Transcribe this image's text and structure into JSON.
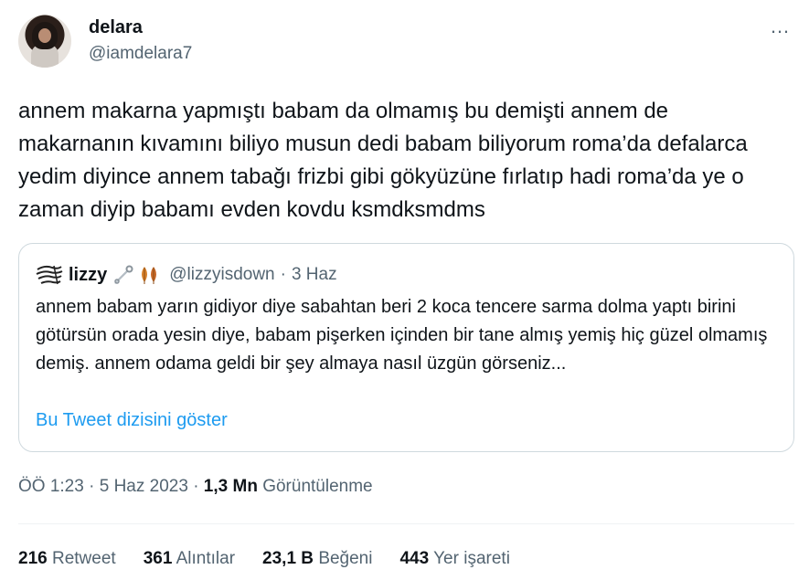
{
  "author": {
    "name": "delara",
    "handle": "@iamdelara7",
    "avatar_icon": "profile-photo"
  },
  "more_icon": "…",
  "tweet": {
    "text": "annem makarna yapmıştı babam da olmamış bu demişti annem de makarnanın kıvamını biliyo musun dedi babam biliyorum roma’da defalarca yedim diyince annem tabağı frizbi gibi gökyüzüne fırlatıp hadi roma’da ye o zaman diyip babamı evden kovdu ksmdksmdms"
  },
  "quote": {
    "name": "lizzy",
    "emoji_icons": [
      "safety-pin-icon",
      "leaves-icon"
    ],
    "handle": "@lizzyisdown",
    "separator": "·",
    "date": "3 Haz",
    "text": "annem babam yarın gidiyor diye sabahtan beri 2 koca tencere sarma dolma yaptı birini götürsün orada yesin diye, babam pişerken içinden bir tane almış yemiş hiç güzel olmamış demiş. annem odama geldi bir şey almaya nasıl üzgün görseniz...",
    "show_thread": "Bu Tweet dizisini göster"
  },
  "meta": {
    "time": "ÖÖ 1:23",
    "sep1": "·",
    "date": "5 Haz 2023",
    "sep2": "·",
    "views_count": "1,3 Mn",
    "views_label": "Görüntülenme"
  },
  "stats": [
    {
      "count": "216",
      "label": "Retweet"
    },
    {
      "count": "361",
      "label": "Alıntılar"
    },
    {
      "count": "23,1 B",
      "label": "Beğeni"
    },
    {
      "count": "443",
      "label": "Yer işareti"
    }
  ],
  "colors": {
    "text": "#0f1419",
    "secondary": "#536471",
    "link": "#1d9bf0",
    "border": "#cfd9de"
  }
}
